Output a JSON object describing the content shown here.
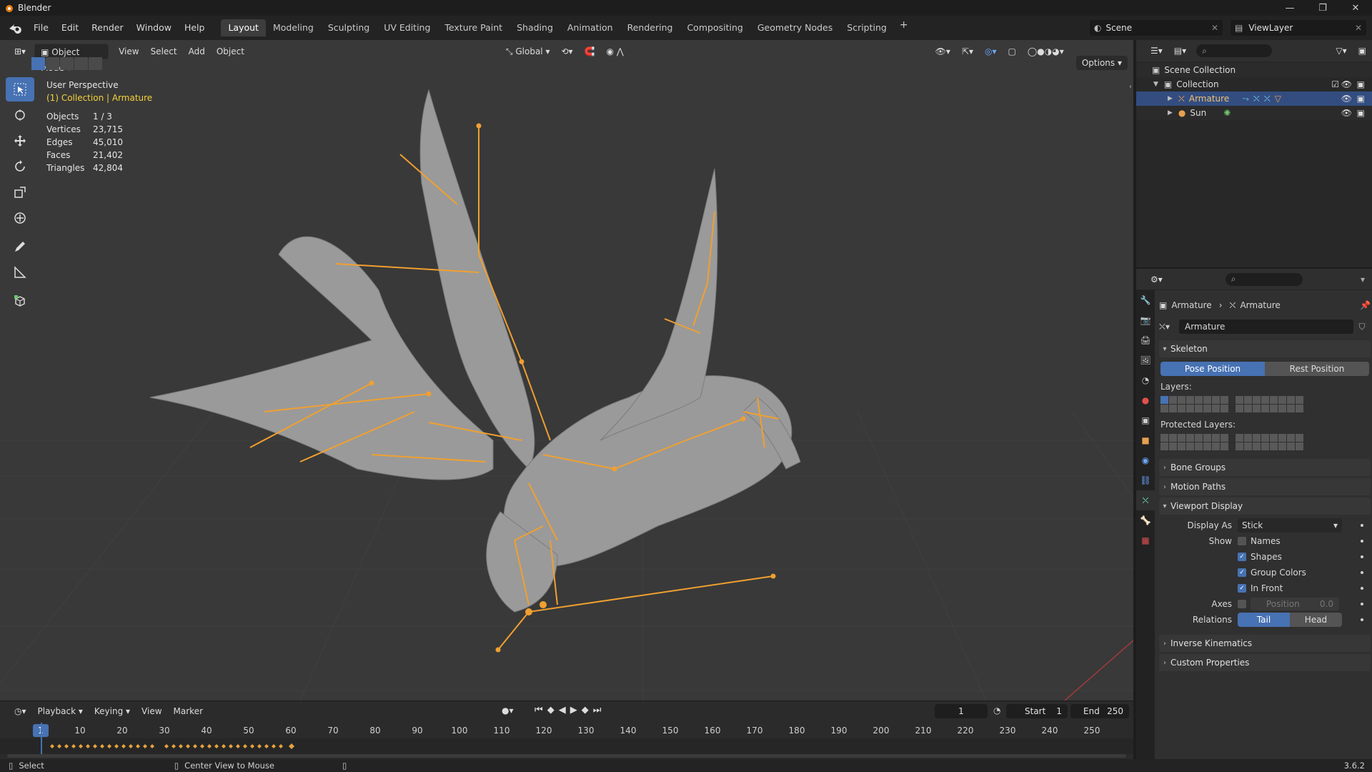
{
  "window": {
    "title": "Blender",
    "minimize": "—",
    "maximize": "❐",
    "close": "✕"
  },
  "menu": {
    "items": [
      "File",
      "Edit",
      "Render",
      "Window",
      "Help"
    ]
  },
  "workspaces": {
    "tabs": [
      "Layout",
      "Modeling",
      "Sculpting",
      "UV Editing",
      "Texture Paint",
      "Shading",
      "Animation",
      "Rendering",
      "Compositing",
      "Geometry Nodes",
      "Scripting"
    ],
    "active": "Layout",
    "add": "+"
  },
  "scene": {
    "name": "Scene",
    "view_layer": "ViewLayer"
  },
  "viewport": {
    "mode": "Object Mode",
    "menus": [
      "View",
      "Select",
      "Add",
      "Object"
    ],
    "transform": "Global",
    "options": "Options",
    "perspective": "User Perspective",
    "collection": "(1) Collection | Armature",
    "stats": [
      {
        "label": "Objects",
        "value": "1 / 3"
      },
      {
        "label": "Vertices",
        "value": "23,715"
      },
      {
        "label": "Edges",
        "value": "45,010"
      },
      {
        "label": "Faces",
        "value": "21,402"
      },
      {
        "label": "Triangles",
        "value": "42,804"
      }
    ]
  },
  "timeline": {
    "menus": [
      "Playback",
      "Keying",
      "View",
      "Marker"
    ],
    "current_frame": "1",
    "start_label": "Start",
    "start": "1",
    "end_label": "End",
    "end": "250",
    "ticks": [
      "10",
      "20",
      "30",
      "40",
      "50",
      "60",
      "70",
      "80",
      "90",
      "100",
      "110",
      "120",
      "130",
      "140",
      "150",
      "160",
      "170",
      "180",
      "190",
      "200",
      "210",
      "220",
      "230",
      "240",
      "250"
    ],
    "indicator": "1"
  },
  "statusbar": {
    "select": "Select",
    "center": "Center View to Mouse",
    "version": "3.6.2"
  },
  "outliner": {
    "scene_collection": "Scene Collection",
    "collection": "Collection",
    "items": [
      "Armature",
      "Sun"
    ]
  },
  "properties": {
    "breadcrumb_a": "Armature",
    "breadcrumb_b": "Armature",
    "data_name": "Armature",
    "skeleton": "Skeleton",
    "pose_position": "Pose Position",
    "rest_position": "Rest Position",
    "layers": "Layers:",
    "protected_layers": "Protected Layers:",
    "bone_groups": "Bone Groups",
    "motion_paths": "Motion Paths",
    "viewport_display": "Viewport Display",
    "display_as_label": "Display As",
    "display_as": "Stick",
    "show_label": "Show",
    "names": "Names",
    "shapes": "Shapes",
    "group_colors": "Group Colors",
    "in_front": "In Front",
    "axes_label": "Axes",
    "position_label": "Position",
    "position_value": "0.0",
    "relations_label": "Relations",
    "tail": "Tail",
    "head": "Head",
    "inverse_kinematics": "Inverse Kinematics",
    "custom_properties": "Custom Properties"
  },
  "colors": {
    "accent": "#4772b3",
    "bone": "#f0a030",
    "selected_text": "#f5d23b",
    "viewport_bg": "#393939"
  }
}
